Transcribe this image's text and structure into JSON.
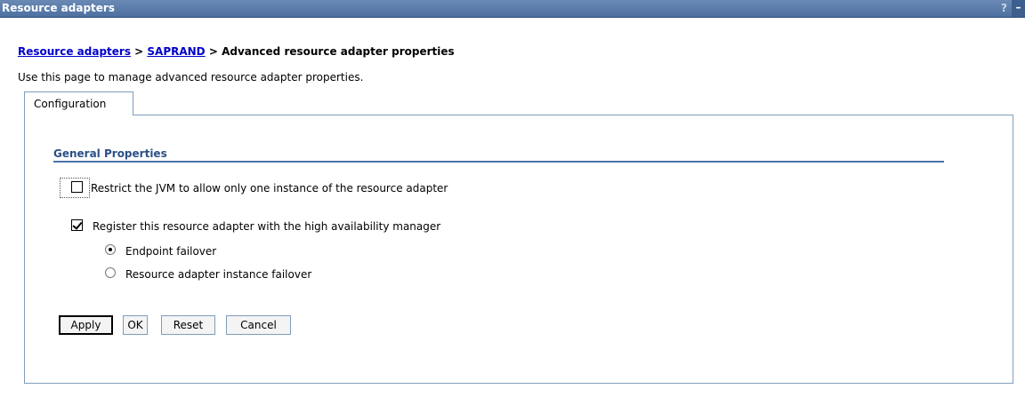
{
  "window": {
    "title": "Resource adapters",
    "help_glyph": "?",
    "minimize_glyph": "–"
  },
  "breadcrumb": {
    "link1": "Resource adapters",
    "sep1": " > ",
    "link2": "SAPRAND",
    "sep2": " > ",
    "current": "Advanced resource adapter properties"
  },
  "description": "Use this page to manage advanced resource adapter properties.",
  "tabs": [
    {
      "label": "Configuration",
      "active": true
    }
  ],
  "general_properties": {
    "heading": "General Properties",
    "restrict_jvm": {
      "label": "Restrict the JVM to allow only one instance of the resource adapter",
      "checked": false
    },
    "register_ha": {
      "label": "Register this resource adapter with the high availability manager",
      "checked": true
    },
    "failover_options": [
      {
        "label": "Endpoint failover",
        "selected": true
      },
      {
        "label": "Resource adapter instance failover",
        "selected": false
      }
    ]
  },
  "buttons": {
    "apply": "Apply",
    "ok": "OK",
    "reset": "Reset",
    "cancel": "Cancel"
  }
}
